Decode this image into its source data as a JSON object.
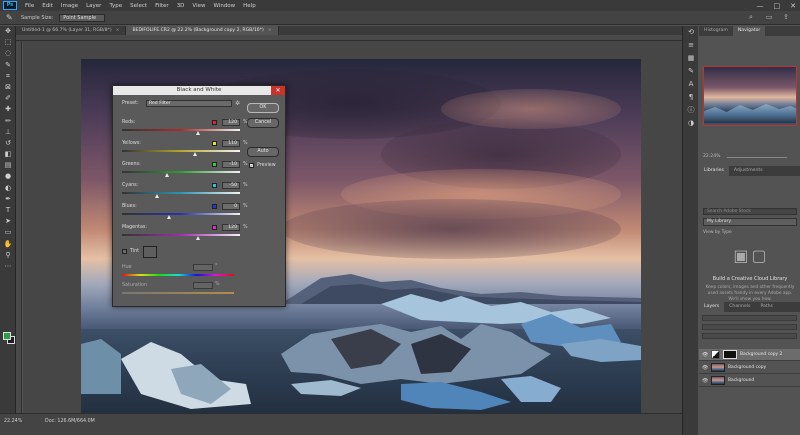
{
  "menu": {
    "logo": "Ps",
    "items": [
      "File",
      "Edit",
      "Image",
      "Layer",
      "Type",
      "Select",
      "Filter",
      "3D",
      "View",
      "Window",
      "Help"
    ],
    "controls": [
      "—",
      "□",
      "✕"
    ]
  },
  "options_bar": {
    "sample_size_label": "Sample Size:",
    "sample_size_value": "Point Sample"
  },
  "tabs": [
    {
      "label": "Untitled-1 @ 66.7% (Layer 31, RGB/8*)",
      "close": "×",
      "active": false
    },
    {
      "label": "BEDIFOLIFE.CR2 @ 22.2% (Background copy 2, RGB/16*)",
      "close": "×",
      "active": true
    }
  ],
  "dialog": {
    "title": "Black and White",
    "close": "✕",
    "preset_label": "Preset:",
    "preset_value": "Red Filter",
    "gear": "✲",
    "ok": "OK",
    "cancel": "Cancel",
    "auto": "Auto",
    "preview_label": "Preview",
    "preview_checked": "✓",
    "channels": [
      {
        "name": "Reds:",
        "value": "120",
        "unit": "%",
        "swatch": "#e0262b",
        "level": 120,
        "gradient": "linear-gradient(90deg,#333,#b02a2a,#f2f2f2)"
      },
      {
        "name": "Yellows:",
        "value": "110",
        "unit": "%",
        "swatch": "#e8dd2a",
        "level": 110,
        "gradient": "linear-gradient(90deg,#333,#b5a72a,#f2f2f2)"
      },
      {
        "name": "Greens:",
        "value": "-10",
        "unit": "%",
        "swatch": "#34c93b",
        "level": -10,
        "gradient": "linear-gradient(90deg,#333,#2f9e35,#f2f2f2)"
      },
      {
        "name": "Cyans:",
        "value": "-50",
        "unit": "%",
        "swatch": "#2ec3d6",
        "level": -50,
        "gradient": "linear-gradient(90deg,#333,#2a97b3,#f2f2f2)"
      },
      {
        "name": "Blues:",
        "value": "0",
        "unit": "%",
        "swatch": "#2637d9",
        "level": 0,
        "gradient": "linear-gradient(90deg,#333,#2832b0,#f2f2f2)"
      },
      {
        "name": "Magentas:",
        "value": "120",
        "unit": "%",
        "swatch": "#d12bd3",
        "level": 120,
        "gradient": "linear-gradient(90deg,#333,#a529b4,#f2f2f2)"
      }
    ],
    "tint_label": "Tint",
    "hue_label": "Hue",
    "hue_unit": "°",
    "saturation_label": "Saturation",
    "saturation_unit": "%"
  },
  "status": {
    "zoom": "22.24%",
    "doc": "Doc: 126.6M/664.0M"
  },
  "panels": {
    "top_tabs": [
      "Histogram",
      "Navigator"
    ],
    "nav_zoom": "22.24%",
    "library_tabs": [
      "Libraries",
      "Adjustments"
    ],
    "library_search": "Search Adobe Stock",
    "library_select": "My Library",
    "view_by": "View by Type",
    "library_title": "Build a Creative Cloud Library",
    "library_desc": "Keep colors, images and other frequently used assets handy in every Adobe app. We'll show you how.",
    "layers_tabs": [
      "Layers",
      "Channels",
      "Paths"
    ],
    "layers": [
      {
        "name": "Background copy 2",
        "selected": true
      },
      {
        "name": "Background copy",
        "selected": false
      },
      {
        "name": "Background",
        "selected": false
      }
    ]
  }
}
